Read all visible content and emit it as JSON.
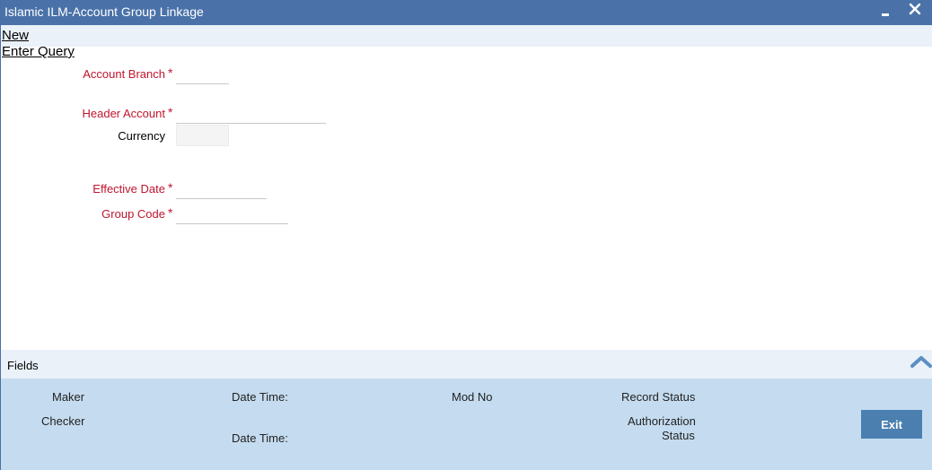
{
  "window": {
    "title": "Islamic ILM-Account Group Linkage"
  },
  "menu": {
    "new_label": "New",
    "enter_query_label": "Enter Query"
  },
  "form": {
    "account_branch": {
      "label": "Account Branch",
      "required_mark": "*",
      "value": ""
    },
    "header_account": {
      "label": "Header Account",
      "required_mark": "*",
      "value": ""
    },
    "currency": {
      "label": "Currency",
      "value": ""
    },
    "effective_date": {
      "label": "Effective Date",
      "required_mark": "*",
      "value": ""
    },
    "group_code": {
      "label": "Group Code",
      "required_mark": "*",
      "value": ""
    }
  },
  "fields_bar": {
    "label": "Fields"
  },
  "footer": {
    "maker_label": "Maker",
    "checker_label": "Checker",
    "date_time_label_1": "Date Time:",
    "date_time_label_2": "Date Time:",
    "mod_no_label": "Mod No",
    "record_status_label": "Record Status",
    "authorization_label_line1": "Authorization",
    "authorization_label_line2": "Status",
    "exit_label": "Exit"
  },
  "colors": {
    "title_bar": "#4a72a9",
    "required_label": "#c0152f",
    "footer_bg": "#c5dcf0",
    "exit_button": "#4a7fb0"
  },
  "icons": {
    "minimize": "minimize-icon",
    "close": "close-icon",
    "collapse": "chevron-up-icon"
  }
}
